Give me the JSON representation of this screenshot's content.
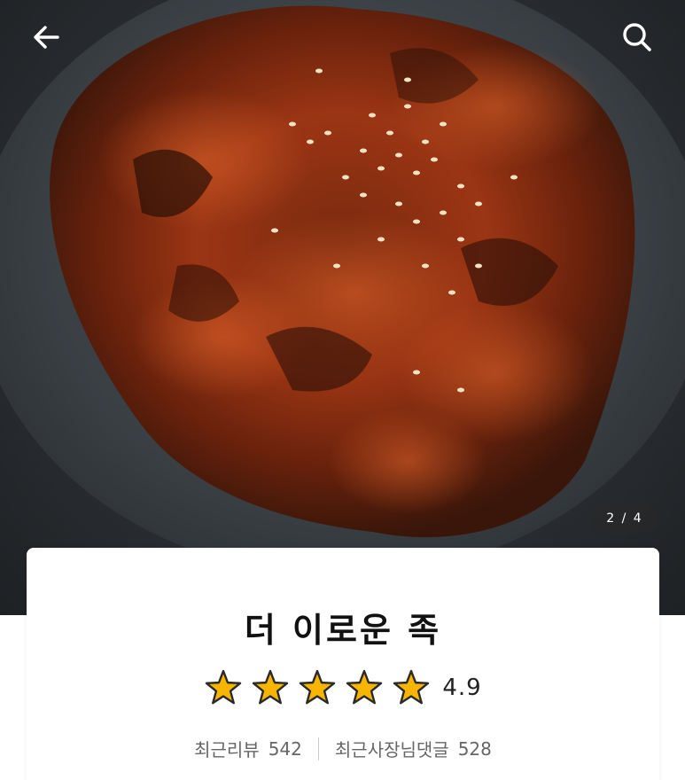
{
  "header": {
    "back_icon": "arrow-left-icon",
    "search_icon": "search-icon"
  },
  "gallery": {
    "pager": "2 / 4"
  },
  "store": {
    "name": "더 이로운 족",
    "rating": 4.9,
    "rating_text": "4.9",
    "star_count": 5,
    "star_color": "#f7b500",
    "recent_reviews_label": "최근리뷰",
    "recent_reviews_count": "542",
    "owner_comments_label": "최근사장님댓글",
    "owner_comments_count": "528"
  }
}
